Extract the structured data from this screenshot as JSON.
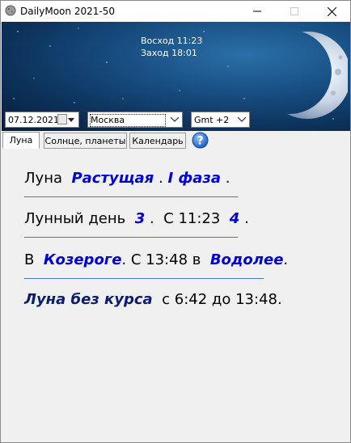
{
  "window": {
    "title": "DailyMoon 2021-50"
  },
  "banner": {
    "sunrise": "Восход 11:23",
    "sunset": "Заход 18:01"
  },
  "controls": {
    "date": "07.12.2021",
    "city": "Москва",
    "gmt": "Gmt +2"
  },
  "tabs": [
    {
      "label": "Луна"
    },
    {
      "label": "Солнце, планеты"
    },
    {
      "label": "Календарь"
    }
  ],
  "moon_info": {
    "line1": {
      "prefix": "Луна",
      "phase": "Растущая",
      "sep": ".",
      "quarter": "I фаза",
      "end": "."
    },
    "line2": {
      "prefix": "Лунный день",
      "day": "3",
      "sep": ".",
      "since": "С 11:23",
      "next_day": "4",
      "end": "."
    },
    "line3": {
      "prefix": "В",
      "sign1": "Козероге",
      "since": ". С 13:48 в",
      "sign2": "Водолее",
      "end": "."
    },
    "line4": {
      "label": "Луна без курса",
      "range": "с 6:42 до 13:48."
    }
  },
  "colors": {
    "accent": "#0000d6",
    "dark_accent": "#0a1e6e",
    "rule": "#3d7bc8",
    "banner": "#184f83"
  },
  "icons": [
    "moon-app-icon",
    "minimize-icon",
    "maximize-icon",
    "close-icon",
    "calendar-icon",
    "chevron-down-icon",
    "help-icon"
  ]
}
